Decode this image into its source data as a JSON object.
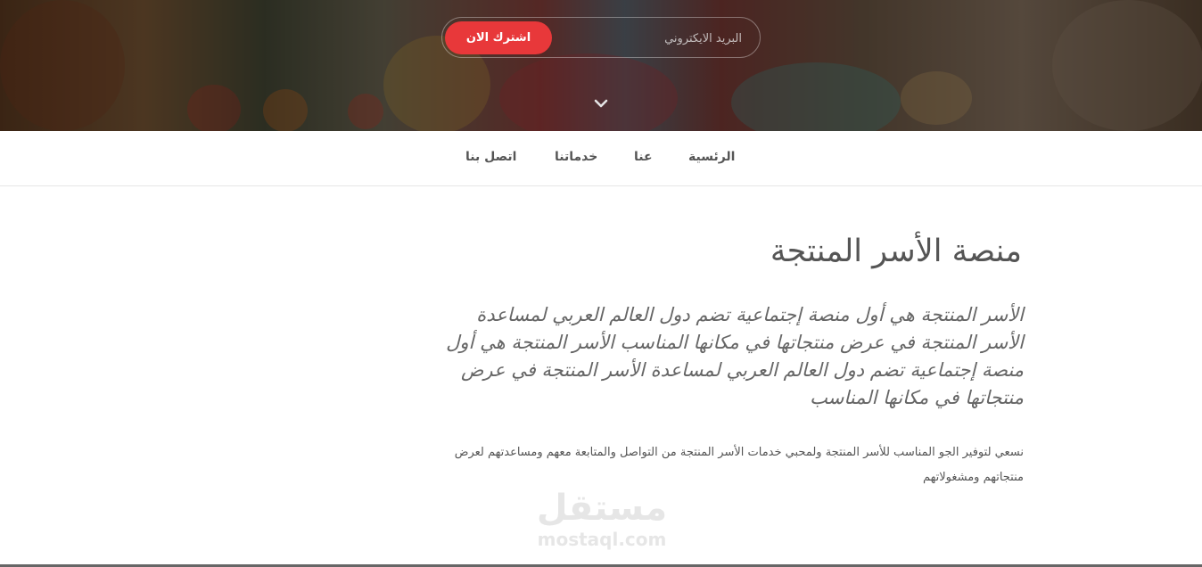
{
  "hero": {
    "email_placeholder": "البريد الايكتروني",
    "subscribe_label": "اشترك الان",
    "accent_color": "#e8383a",
    "scroll_icon": "chevron-down-icon"
  },
  "nav": {
    "items": [
      {
        "label": "الرئسية"
      },
      {
        "label": "عنا"
      },
      {
        "label": "خدماتنا"
      },
      {
        "label": "اتصل بنا"
      }
    ]
  },
  "main": {
    "title": "منصة الأسر المنتجة",
    "lead": "الأسر المنتجة هي أول منصة إجتماعية تضم دول العالم العربي لمساعدة الأسر المنتجة في عرض منتجاتها في مكانها المناسب الأسر المنتجة هي أول منصة إجتماعية تضم دول العالم العربي لمساعدة الأسر المنتجة في عرض منتجاتها في مكانها المناسب",
    "body": "نسعي لتوفير الجو المناسب للأسر المنتجة ولمحبي خدمات الأسر المنتجة من التواصل والمتابعة معهم ومساعدتهم لعرض منتجاتهم ومشغولاتهم"
  },
  "watermark": {
    "arabic": "مستقل",
    "latin": "mostaql.com"
  }
}
